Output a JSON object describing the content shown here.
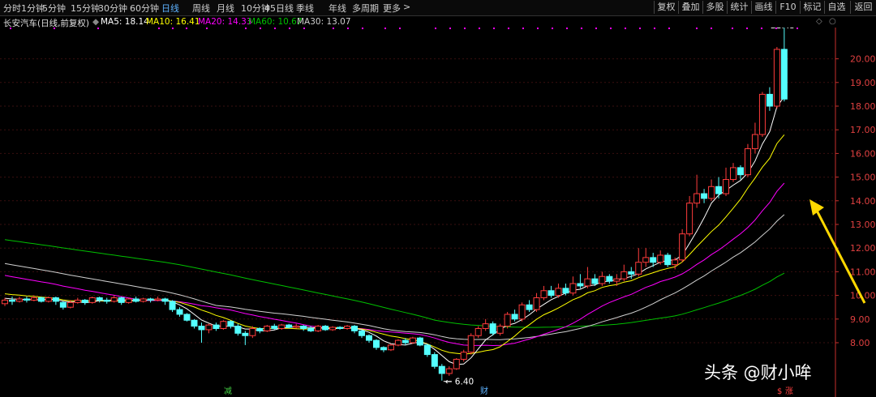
{
  "toolbar": {
    "periods": [
      "分时",
      "1分钟",
      "5分钟",
      "15分钟",
      "30分钟",
      "60分钟",
      "日线",
      "周线",
      "月线",
      "10分钟",
      "45日线",
      "季线",
      "年线",
      "多周期",
      "更多"
    ],
    "active": "日线",
    "more_arrow": ">",
    "right_buttons": [
      "复权",
      "叠加",
      "多股",
      "统计",
      "画线",
      "F10",
      "标记",
      "自选",
      "返回"
    ]
  },
  "legend": {
    "stock": "长安汽车(日线,前复权)",
    "ma5": "MA5: 18.14",
    "ma10": "MA10: 16.41",
    "ma20": "MA20: 14.33",
    "ma60": "MA60: 10.67",
    "ma30": "MA30: 13.07"
  },
  "colors": {
    "up": "#ff3c3c",
    "down": "#54ffff",
    "ma5": "#ffffff",
    "ma10": "#ffff00",
    "ma20": "#ff00ff",
    "ma30": "#d0d0d0",
    "ma60": "#00c000",
    "axis": "#c8302c",
    "dots": "#ff00ff"
  },
  "watermark": "头条 @财小哞",
  "chart_data": {
    "type": "candlestick",
    "yaxis_ticks": [
      "8.00",
      "9.00",
      "10.00",
      "11.00",
      "12.00",
      "13.00",
      "14.00",
      "15.00",
      "16.00",
      "17.00",
      "18.00",
      "19.00",
      "20.00"
    ],
    "ylim": [
      7.6,
      21.6
    ],
    "max_label": "21.43",
    "min_label": "6.40",
    "max_value": 21.43,
    "min_value": 6.4,
    "markers": [
      "减",
      "财",
      "涨"
    ],
    "badge": "$",
    "candles": [
      [
        9.65,
        9.8,
        9.9,
        9.55
      ],
      [
        9.8,
        9.75,
        9.95,
        9.6
      ],
      [
        9.75,
        9.85,
        9.95,
        9.7
      ],
      [
        9.85,
        9.8,
        9.95,
        9.7
      ],
      [
        9.8,
        9.9,
        10.0,
        9.75
      ],
      [
        9.9,
        9.75,
        9.95,
        9.7
      ],
      [
        9.75,
        9.9,
        9.95,
        9.7
      ],
      [
        9.9,
        9.75,
        9.95,
        9.6
      ],
      [
        9.7,
        9.5,
        9.75,
        9.4
      ],
      [
        9.5,
        9.7,
        9.8,
        9.45
      ],
      [
        9.7,
        9.8,
        9.9,
        9.65
      ],
      [
        9.8,
        9.7,
        9.85,
        9.6
      ],
      [
        9.7,
        9.9,
        9.95,
        9.65
      ],
      [
        9.9,
        9.8,
        9.95,
        9.7
      ],
      [
        9.8,
        9.75,
        9.9,
        9.65
      ],
      [
        9.75,
        9.9,
        10.0,
        9.7
      ],
      [
        9.9,
        9.7,
        9.95,
        9.6
      ],
      [
        9.7,
        9.85,
        9.9,
        9.65
      ],
      [
        9.85,
        9.75,
        9.95,
        9.7
      ],
      [
        9.75,
        9.85,
        9.9,
        9.7
      ],
      [
        9.85,
        9.8,
        9.9,
        9.7
      ],
      [
        9.8,
        9.85,
        9.95,
        9.75
      ],
      [
        9.85,
        9.75,
        9.9,
        9.6
      ],
      [
        9.75,
        9.4,
        9.8,
        9.3
      ],
      [
        9.4,
        9.2,
        9.5,
        9.1
      ],
      [
        9.2,
        8.95,
        9.25,
        8.9
      ],
      [
        8.95,
        8.7,
        9.0,
        8.6
      ],
      [
        8.7,
        8.55,
        8.85,
        8.0
      ],
      [
        8.55,
        8.75,
        8.8,
        8.4
      ],
      [
        8.75,
        8.6,
        8.85,
        8.5
      ],
      [
        8.6,
        8.9,
        8.95,
        8.55
      ],
      [
        8.9,
        8.7,
        8.95,
        8.6
      ],
      [
        8.7,
        8.4,
        8.8,
        8.3
      ],
      [
        8.4,
        8.3,
        8.5,
        7.9
      ],
      [
        8.3,
        8.6,
        8.7,
        8.2
      ],
      [
        8.6,
        8.5,
        8.65,
        8.4
      ],
      [
        8.5,
        8.7,
        8.75,
        8.45
      ],
      [
        8.7,
        8.6,
        8.8,
        8.55
      ],
      [
        8.6,
        8.75,
        8.8,
        8.55
      ],
      [
        8.75,
        8.65,
        8.8,
        8.6
      ],
      [
        8.65,
        8.7,
        8.8,
        8.6
      ],
      [
        8.7,
        8.6,
        8.75,
        8.5
      ],
      [
        8.6,
        8.5,
        8.7,
        8.45
      ],
      [
        8.5,
        8.7,
        8.75,
        8.45
      ],
      [
        8.7,
        8.55,
        8.75,
        8.5
      ],
      [
        8.55,
        8.65,
        8.7,
        8.5
      ],
      [
        8.65,
        8.6,
        8.7,
        8.55
      ],
      [
        8.6,
        8.7,
        8.75,
        8.55
      ],
      [
        8.7,
        8.5,
        8.75,
        8.4
      ],
      [
        8.5,
        8.3,
        8.55,
        8.2
      ],
      [
        8.3,
        8.1,
        8.35,
        8.0
      ],
      [
        8.1,
        7.8,
        8.15,
        7.7
      ],
      [
        7.8,
        7.7,
        7.85,
        7.6
      ],
      [
        7.7,
        7.9,
        7.95,
        7.65
      ],
      [
        7.9,
        8.1,
        8.15,
        7.85
      ],
      [
        8.1,
        8.0,
        8.2,
        7.9
      ],
      [
        8.0,
        8.2,
        8.25,
        7.95
      ],
      [
        8.2,
        7.9,
        8.25,
        7.85
      ],
      [
        7.9,
        7.5,
        7.95,
        7.4
      ],
      [
        7.5,
        7.0,
        7.6,
        6.9
      ],
      [
        7.0,
        6.7,
        7.1,
        6.4
      ],
      [
        6.7,
        6.9,
        7.0,
        6.6
      ],
      [
        6.9,
        7.3,
        7.35,
        6.85
      ],
      [
        7.3,
        7.6,
        7.7,
        7.2
      ],
      [
        7.6,
        8.3,
        8.4,
        7.5
      ],
      [
        8.3,
        8.6,
        8.7,
        8.2
      ],
      [
        8.6,
        8.8,
        9.0,
        8.5
      ],
      [
        8.8,
        8.4,
        8.9,
        8.3
      ],
      [
        8.4,
        8.7,
        8.8,
        8.3
      ],
      [
        8.7,
        9.2,
        9.3,
        8.6
      ],
      [
        9.2,
        9.0,
        9.4,
        8.9
      ],
      [
        9.0,
        9.6,
        9.7,
        8.9
      ],
      [
        9.6,
        9.4,
        9.8,
        9.3
      ],
      [
        9.4,
        9.9,
        10.1,
        9.3
      ],
      [
        9.9,
        10.2,
        10.4,
        9.8
      ],
      [
        10.2,
        10.0,
        10.4,
        9.9
      ],
      [
        10.0,
        10.3,
        10.5,
        9.9
      ],
      [
        10.3,
        10.1,
        10.5,
        10.0
      ],
      [
        10.1,
        10.5,
        10.8,
        10.0
      ],
      [
        10.5,
        10.4,
        10.9,
        10.3
      ],
      [
        10.4,
        10.7,
        11.2,
        10.3
      ],
      [
        10.7,
        10.5,
        10.9,
        10.4
      ],
      [
        10.5,
        10.8,
        11.0,
        10.4
      ],
      [
        10.8,
        10.6,
        10.9,
        10.5
      ],
      [
        10.6,
        10.7,
        10.9,
        10.4
      ],
      [
        10.7,
        11.0,
        11.3,
        10.6
      ],
      [
        11.0,
        10.9,
        11.2,
        10.7
      ],
      [
        10.9,
        11.4,
        12.0,
        10.8
      ],
      [
        11.4,
        11.6,
        12.0,
        11.2
      ],
      [
        11.6,
        11.4,
        11.8,
        11.2
      ],
      [
        11.4,
        11.7,
        11.9,
        11.3
      ],
      [
        11.7,
        11.3,
        11.8,
        11.2
      ],
      [
        11.3,
        11.5,
        11.6,
        11.1
      ],
      [
        11.5,
        12.6,
        12.8,
        11.4
      ],
      [
        12.6,
        13.9,
        14.2,
        12.5
      ],
      [
        13.9,
        14.3,
        15.1,
        13.7
      ],
      [
        14.3,
        14.1,
        14.5,
        13.9
      ],
      [
        14.1,
        14.6,
        14.9,
        14.0
      ],
      [
        14.6,
        14.3,
        15.0,
        14.1
      ],
      [
        14.3,
        14.9,
        15.4,
        14.2
      ],
      [
        14.9,
        15.4,
        15.6,
        14.8
      ],
      [
        15.4,
        15.1,
        15.5,
        14.9
      ],
      [
        15.1,
        16.2,
        16.4,
        15.0
      ],
      [
        16.2,
        16.8,
        17.3,
        16.0
      ],
      [
        16.8,
        18.5,
        18.6,
        16.7
      ],
      [
        18.5,
        18.0,
        18.8,
        17.8
      ],
      [
        18.0,
        20.4,
        20.5,
        17.9
      ],
      [
        20.4,
        18.3,
        21.43,
        18.2
      ]
    ]
  }
}
